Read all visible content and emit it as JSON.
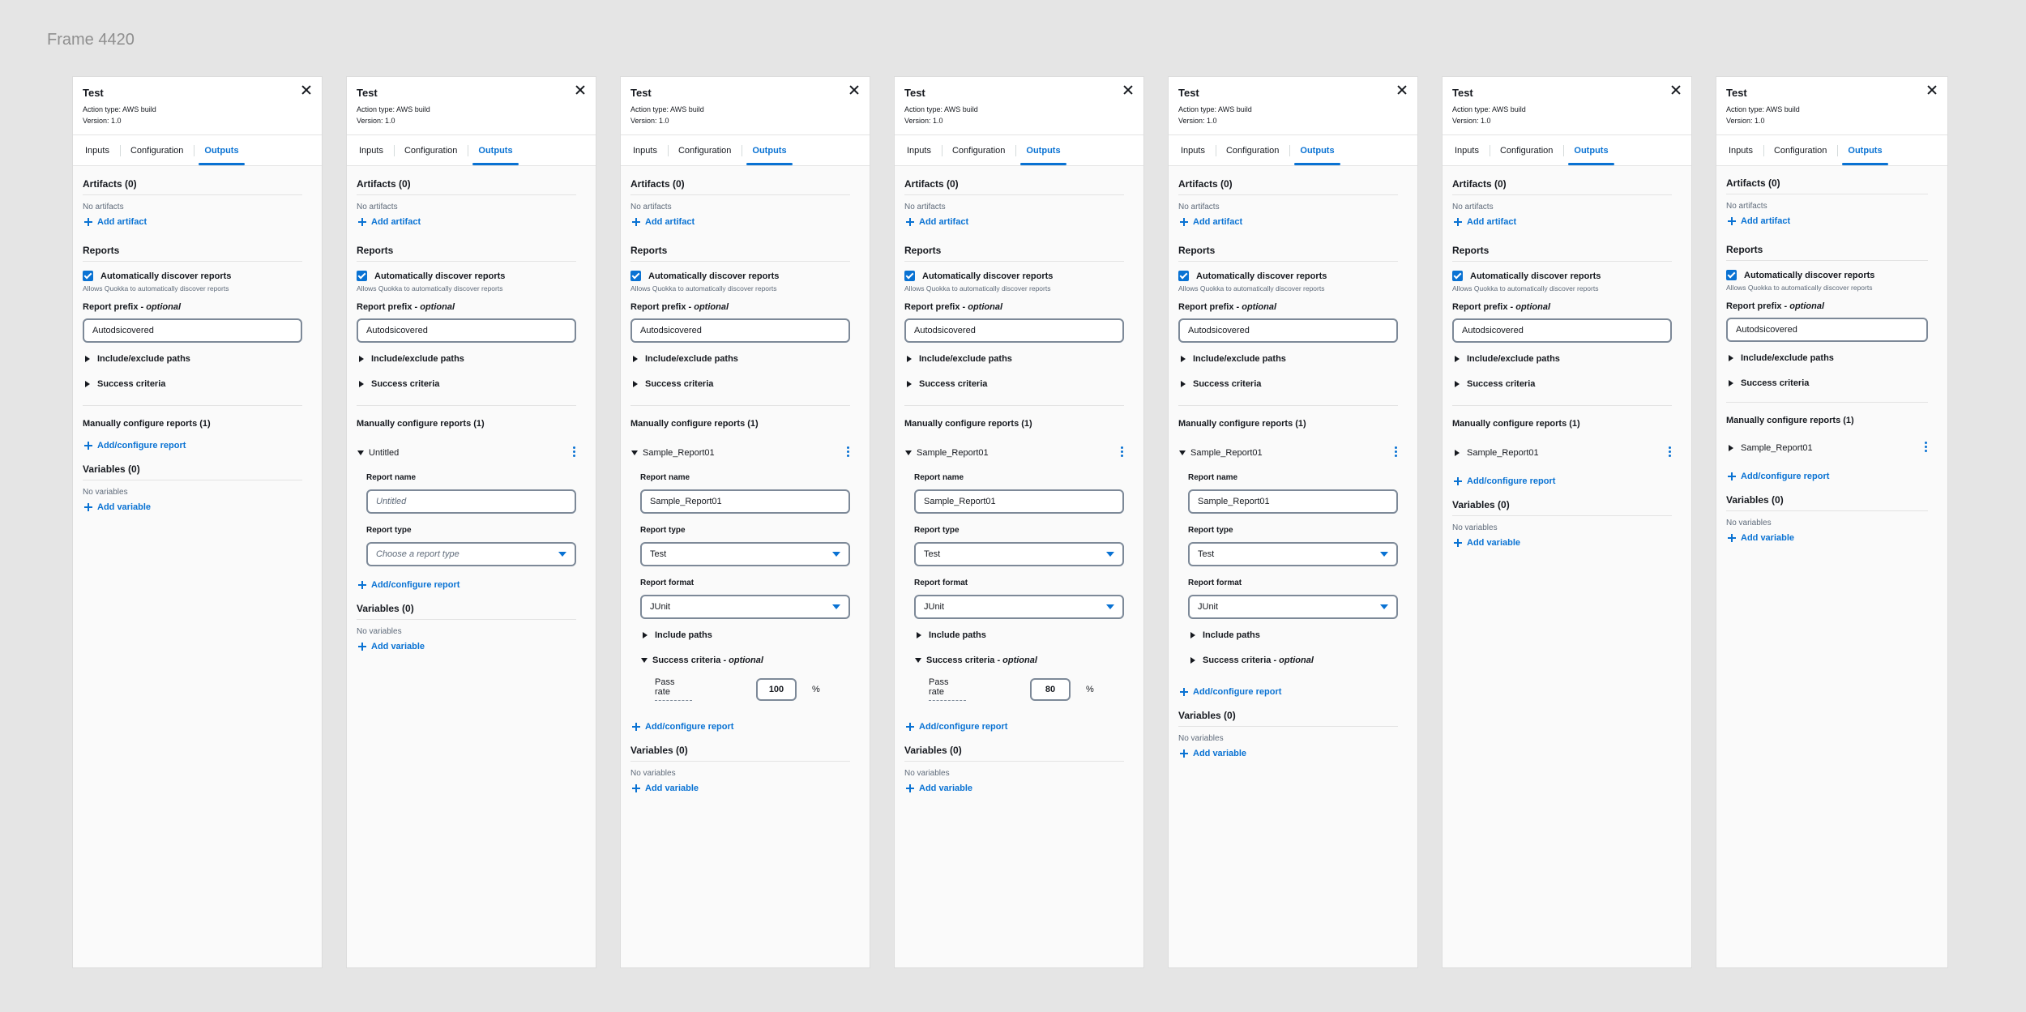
{
  "frame_title": "Frame 4420",
  "panel": {
    "title": "Test",
    "action_type": "Action type: AWS build",
    "version": "Version: 1.0",
    "tabs": [
      "Inputs",
      "Configuration",
      "Outputs"
    ],
    "artifacts_heading": "Artifacts (0)",
    "no_artifacts": "No artifacts",
    "add_artifact": "Add artifact",
    "reports_heading": "Reports",
    "auto_discover": "Automatically discover reports",
    "auto_discover_hint": "Allows Quokka to automatically discover reports",
    "report_prefix_label": "Report prefix - ",
    "optional": "optional",
    "report_prefix_value": "Autodsicovered",
    "include_exclude": "Include/exclude paths",
    "success_criteria": "Success criteria",
    "manual_heading": "Manually configure reports (1)",
    "add_configure_report": "Add/configure report",
    "variables_heading": "Variables (0)",
    "no_variables": "No variables",
    "add_variable": "Add variable",
    "report_name_label": "Report name",
    "report_type_label": "Report type",
    "report_format_label": "Report format",
    "include_paths": "Include paths",
    "success_criteria_opt": "Success criteria - ",
    "pass_rate": "Pass rate",
    "percent": "%",
    "untitled": "Untitled",
    "untitled_placeholder": "Untitled",
    "report_type_placeholder": "Choose a report type",
    "report_name_value": "Sample_Report01",
    "report_type_value": "Test",
    "report_format_value": "JUnit",
    "pass_rate_100": "100",
    "pass_rate_80": "80"
  }
}
